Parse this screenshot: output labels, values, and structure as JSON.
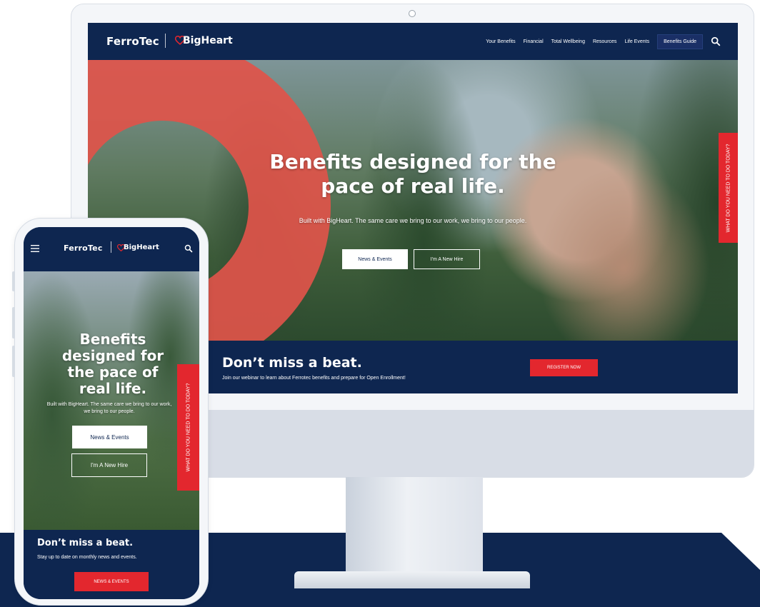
{
  "brand": {
    "primary_logo": "FerroTec",
    "secondary_logo": "BigHeart",
    "navy": "#0e2650",
    "red": "#e3272e",
    "coral": "#e0544a"
  },
  "desktop": {
    "nav": {
      "items": [
        "Your Benefits",
        "Financial",
        "Total Wellbeing",
        "Resources",
        "Life Events"
      ],
      "cta_label": "Benefits Guide",
      "search_icon": "search-icon"
    },
    "hero": {
      "title": "Benefits designed for the pace of real life.",
      "subtitle": "Built with BigHeart. The same care we bring to our work, we bring to our people.",
      "primary_button": "News & Events",
      "secondary_button": "I'm A New Hire",
      "side_tab": "WHAT DO YOU NEED TO DO TODAY?"
    },
    "banner": {
      "title": "Don’t miss a beat.",
      "subtitle": "Join our webinar to learn about Ferrotec benefits and prepare for Open Enrollment!",
      "button": "REGISTER NOW"
    }
  },
  "mobile": {
    "nav": {
      "menu_icon": "hamburger-icon",
      "search_icon": "search-icon"
    },
    "hero": {
      "title": "Benefits designed for the pace of real life.",
      "subtitle": "Built with BigHeart. The same care we bring to our work, we bring to our people.",
      "primary_button": "News & Events",
      "secondary_button": "I'm A New Hire",
      "side_tab": "WHAT DO YOU NEED TO DO TODAY?"
    },
    "banner": {
      "title": "Don’t miss a beat.",
      "subtitle": "Stay up to date on monthly news and events.",
      "button": "NEWS & EVENTS"
    }
  }
}
